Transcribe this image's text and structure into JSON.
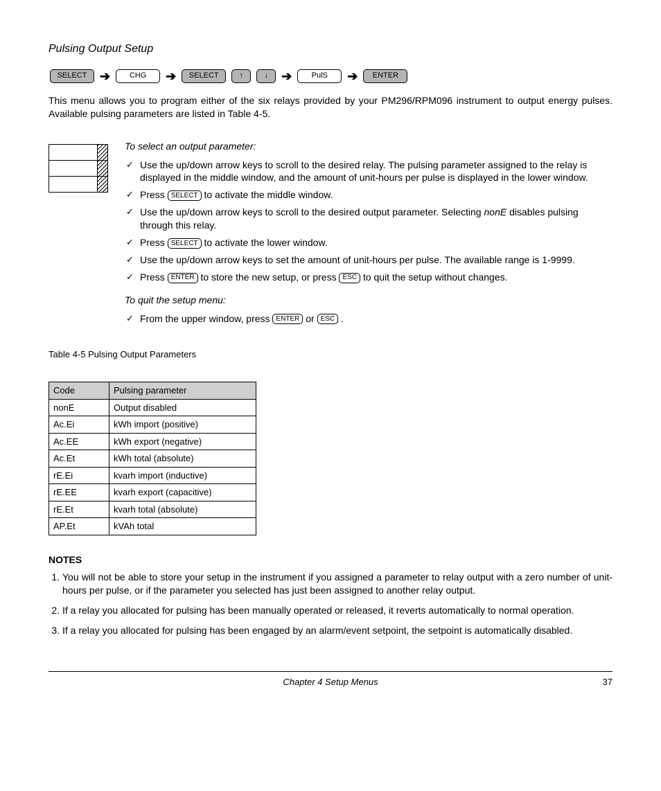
{
  "section_title": "Pulsing Output Setup",
  "keyrow": {
    "k1": "SELECT",
    "k2": "CHG",
    "k3": "SELECT",
    "up": "↑",
    "down": "↓",
    "k4": "PulS",
    "k5": "ENTER"
  },
  "intro": "This menu allows you to program either of the six relays provided by your PM296/RPM096 instrument to output energy pulses. Available pulsing parameters are listed in Table 4-5.",
  "select_h": "To select an output parameter:",
  "steps": {
    "s1": "Use the up/down arrow keys to scroll to the desired relay. The pulsing parameter assigned to the relay is displayed in the middle window, and the amount of unit-hours per pulse is displayed in the lower window.",
    "s2a": "Press",
    "s2b": "to activate the middle window.",
    "s3a": "Use the up/down arrow keys to scroll to the desired output parameter. Selecting",
    "s3_em": "nonE",
    "s3b": "disables pulsing through this relay.",
    "s4a": "Press",
    "s4b": "to activate the lower window.",
    "s5": "Use the up/down arrow keys to set the amount of unit-hours per pulse. The available range is 1-9999.",
    "s6a": "Press",
    "s6b": "to store the new setup, or press",
    "s6c": "to quit the setup without changes."
  },
  "quit_h": "To quit the setup menu:",
  "quit_a": "From the upper window, press",
  "quit_or": "or",
  "quit_dot": ".",
  "inline_keys": {
    "select": "SELECT",
    "enter": "ENTER",
    "esc": "ESC"
  },
  "table": {
    "caption": "Table 4-5 Pulsing Output Parameters",
    "h1": "Code",
    "h2": "Pulsing parameter",
    "rows": [
      {
        "code": "nonE",
        "param": "Output disabled"
      },
      {
        "code": "Ac.Ei",
        "param": "kWh import (positive)"
      },
      {
        "code": "Ac.EE",
        "param": "kWh export (negative)"
      },
      {
        "code": "Ac.Et",
        "param": "kWh total (absolute)"
      },
      {
        "code": "rE.Ei",
        "param": "kvarh import (inductive)"
      },
      {
        "code": "rE.EE",
        "param": "kvarh export (capacitive)"
      },
      {
        "code": "rE.Et",
        "param": "kvarh total (absolute)"
      },
      {
        "code": "AP.Et",
        "param": "kVAh total"
      }
    ]
  },
  "notes_h": "NOTES",
  "notes": {
    "n1": "You will not be able to store your setup in the instrument if you assigned a parameter to relay output with a zero number of unit-hours per pulse, or if the parameter you selected has just been assigned to another relay output.",
    "n2": "If a relay you allocated for pulsing has been manually operated or released, it reverts automatically to normal operation.",
    "n3": "If a relay you allocated for pulsing has been engaged by an alarm/event setpoint, the setpoint is automatically disabled."
  },
  "footer": {
    "chapter": "Chapter 4 Setup Menus",
    "page": "37"
  }
}
